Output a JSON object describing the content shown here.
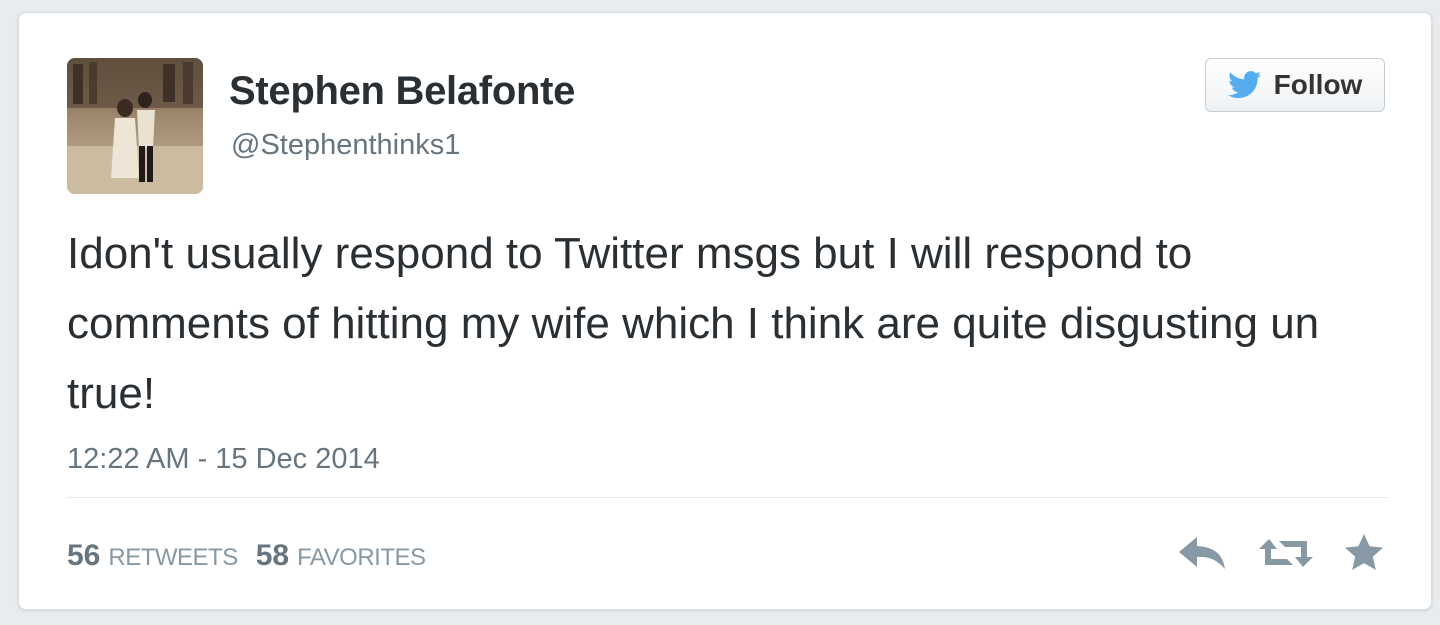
{
  "tweet": {
    "display_name": "Stephen Belafonte",
    "handle": "@Stephenthinks1",
    "follow_label": "Follow",
    "text": "Idon't usually respond to Twitter msgs but I will respond to comments of hitting my wife which I think are quite disgusting un true!",
    "timestamp": "12:22 AM - 15 Dec 2014",
    "retweets_count": "56",
    "retweets_label": "RETWEETS",
    "favorites_count": "58",
    "favorites_label": "FAVORITES"
  },
  "icons": {
    "follow": "twitter-bird-icon",
    "reply": "reply-icon",
    "retweet": "retweet-icon",
    "favorite": "star-icon"
  },
  "colors": {
    "twitter_blue": "#55acee",
    "text_primary": "#292f33",
    "text_secondary": "#66757f",
    "icon_gray": "#8899a6"
  }
}
